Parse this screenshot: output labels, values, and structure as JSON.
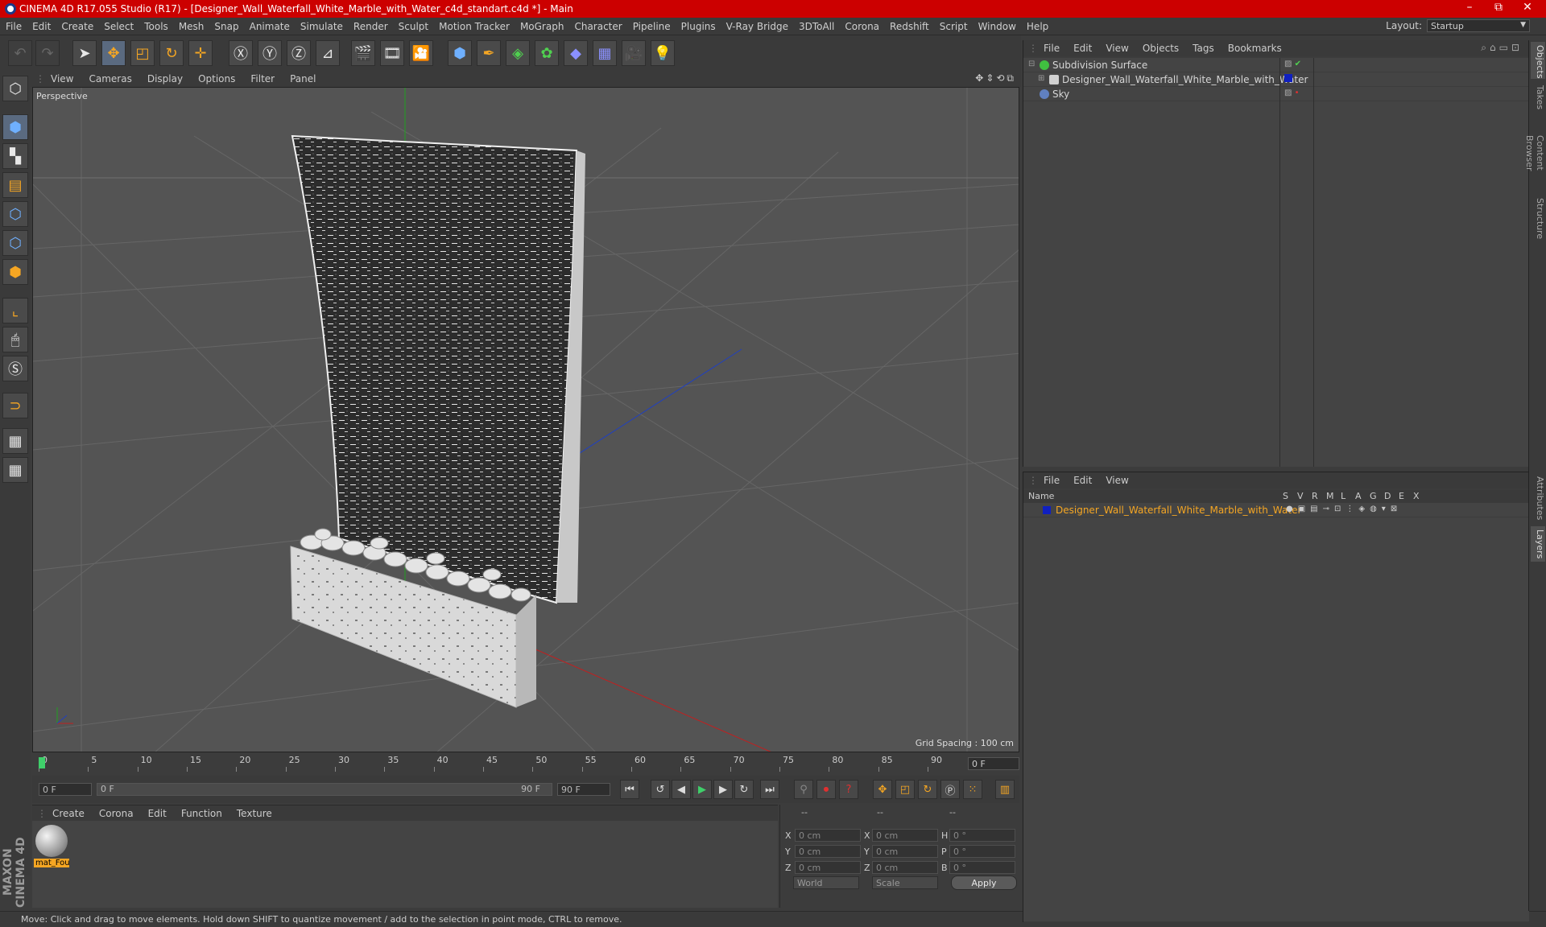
{
  "titlebar": {
    "title": "CINEMA 4D R17.055 Studio (R17) - [Designer_Wall_Waterfall_White_Marble_with_Water_c4d_standart.c4d *] - Main",
    "minimize": "–",
    "maximize": "⧉",
    "close": "✕"
  },
  "menubar": {
    "items": [
      "File",
      "Edit",
      "Create",
      "Select",
      "Tools",
      "Mesh",
      "Snap",
      "Animate",
      "Simulate",
      "Render",
      "Sculpt",
      "Motion Tracker",
      "MoGraph",
      "Character",
      "Pipeline",
      "Plugins",
      "V-Ray Bridge",
      "3DToAll",
      "Corona",
      "Redshift",
      "Script",
      "Window",
      "Help"
    ],
    "layout_label": "Layout:",
    "layout_value": "Startup"
  },
  "viewport": {
    "menu": [
      "View",
      "Cameras",
      "Display",
      "Options",
      "Filter",
      "Panel"
    ],
    "label": "Perspective",
    "grid_spacing": "Grid Spacing : 100 cm",
    "axis_x_color": "#c02020",
    "axis_y_color": "#20a020",
    "axis_z_color": "#2040c0"
  },
  "timeline": {
    "ticks": [
      "0",
      "5",
      "10",
      "15",
      "20",
      "25",
      "30",
      "35",
      "40",
      "45",
      "50",
      "55",
      "60",
      "65",
      "70",
      "75",
      "80",
      "85",
      "90"
    ],
    "current_frame": "0 F"
  },
  "transport": {
    "start": "0 F",
    "range_start": "0 F",
    "range_end": "90 F",
    "end": "90 F"
  },
  "material_manager": {
    "menu": [
      "Create",
      "Corona",
      "Edit",
      "Function",
      "Texture"
    ],
    "materials": [
      {
        "name": "mat_Fou"
      }
    ]
  },
  "coordinates": {
    "headers": [
      "--",
      "--",
      "--"
    ],
    "rows": [
      {
        "a": "X",
        "v1": "0 cm",
        "b": "X",
        "v2": "0 cm",
        "c": "H",
        "v3": "0 °"
      },
      {
        "a": "Y",
        "v1": "0 cm",
        "b": "Y",
        "v2": "0 cm",
        "c": "P",
        "v3": "0 °"
      },
      {
        "a": "Z",
        "v1": "0 cm",
        "b": "Z",
        "v2": "0 cm",
        "c": "B",
        "v3": "0 °"
      }
    ],
    "mode_world": "World",
    "mode_scale": "Scale",
    "apply": "Apply"
  },
  "object_manager": {
    "menu": [
      "File",
      "Edit",
      "View",
      "Objects",
      "Tags",
      "Bookmarks"
    ],
    "objects": [
      {
        "name": "Subdivision Surface",
        "icon_color": "#40c040"
      },
      {
        "name": "Designer_Wall_Waterfall_White_Marble_with_Water",
        "icon_color": "#d0d0d0"
      },
      {
        "name": "Sky",
        "icon_color": "#6080c0"
      }
    ]
  },
  "layer_manager": {
    "menu": [
      "File",
      "Edit",
      "View"
    ],
    "columns": [
      "Name",
      "S",
      "V",
      "R",
      "M",
      "L",
      "A",
      "G",
      "D",
      "E",
      "X"
    ],
    "layers": [
      {
        "name": "Designer_Wall_Waterfall_White_Marble_with_Water",
        "color": "#1020c0"
      }
    ]
  },
  "right_tabs": [
    "Objects",
    "Takes",
    "Content Browser",
    "Structure",
    "Attributes",
    "Layers"
  ],
  "branding": {
    "logo": "MAXON CINEMA 4D"
  },
  "statusbar": {
    "text": "Move: Click and drag to move elements. Hold down SHIFT to quantize movement / add to the selection in point mode, CTRL to remove."
  }
}
